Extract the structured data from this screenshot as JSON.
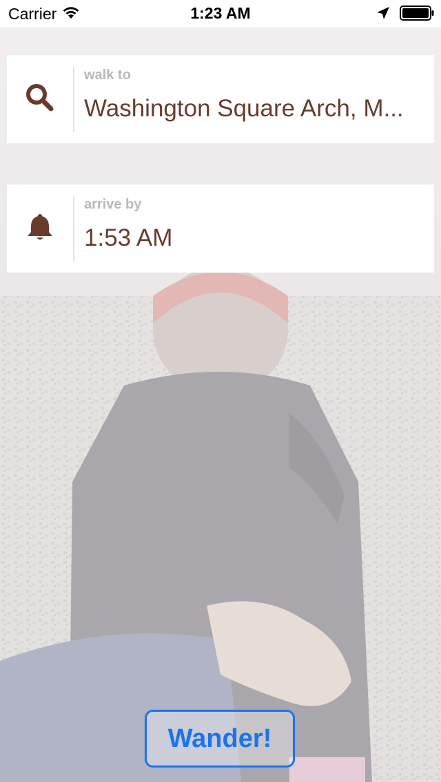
{
  "status_bar": {
    "carrier": "Carrier",
    "time": "1:23 AM",
    "icons": [
      "wifi-icon",
      "location-arrow-icon",
      "battery-icon"
    ]
  },
  "walk_card": {
    "icon": "search-icon",
    "label": "walk to",
    "value": "Washington Square Arch, M..."
  },
  "arrive_card": {
    "icon": "bell-icon",
    "label": "arrive by",
    "value": "1:53 AM"
  },
  "action": {
    "wander_label": "Wander!"
  },
  "colors": {
    "accent_brown": "#6a3b2c",
    "label_gray": "#b9b9b9",
    "button_blue": "#1a73f0"
  }
}
